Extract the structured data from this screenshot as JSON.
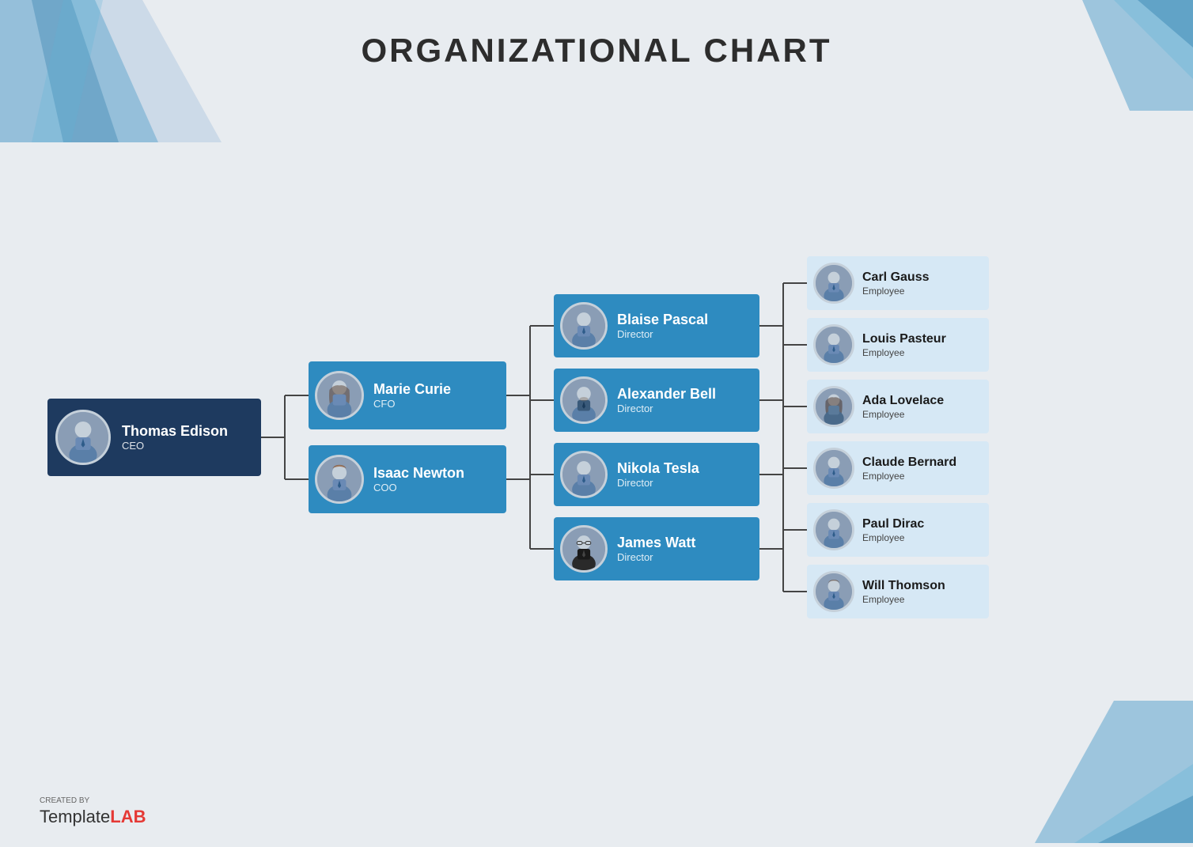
{
  "title": "ORGANIZATIONAL CHART",
  "ceo": {
    "name": "Thomas Edison",
    "role": "CEO"
  },
  "l2": [
    {
      "name": "Marie Curie",
      "role": "CFO"
    },
    {
      "name": "Isaac Newton",
      "role": "COO"
    }
  ],
  "directors": [
    {
      "name": "Blaise Pascal",
      "role": "Director"
    },
    {
      "name": "Alexander Bell",
      "role": "Director"
    },
    {
      "name": "Nikola Tesla",
      "role": "Director"
    },
    {
      "name": "James Watt",
      "role": "Director"
    }
  ],
  "employees": [
    {
      "name": "Carl Gauss",
      "role": "Employee"
    },
    {
      "name": "Louis Pasteur",
      "role": "Employee"
    },
    {
      "name": "Ada Lovelace",
      "role": "Employee"
    },
    {
      "name": "Claude Bernard",
      "role": "Employee"
    },
    {
      "name": "Paul Dirac",
      "role": "Employee"
    },
    {
      "name": "Will Thomson",
      "role": "Employee"
    }
  ],
  "footer": {
    "created_by": "CREATED BY",
    "brand_light": "Template",
    "brand_bold": "LAB"
  },
  "colors": {
    "ceo_bg": "#1e3a5f",
    "l2_bg": "#2e8bc0",
    "director_bg": "#2e8bc0",
    "employee_bg": "#d6e8f5",
    "avatar_bg": "#8a9db5",
    "line_color": "#444"
  }
}
